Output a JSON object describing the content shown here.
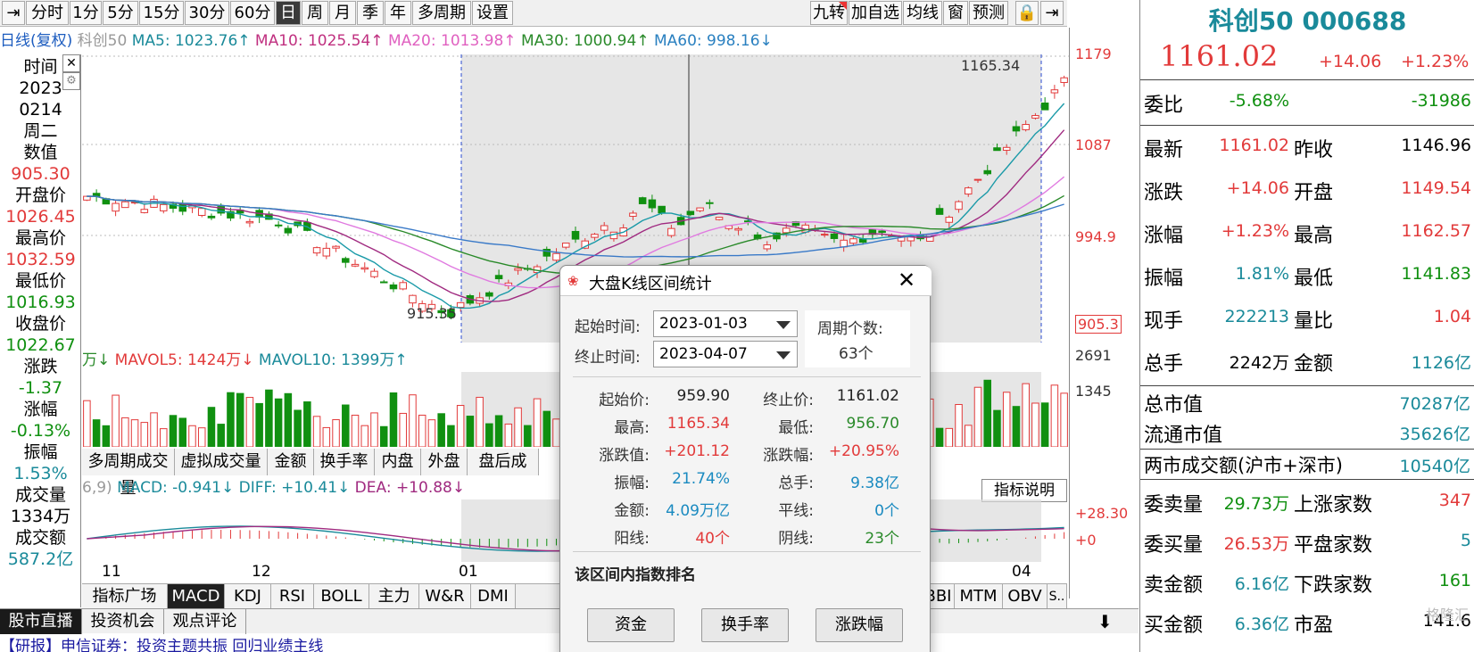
{
  "toolbar": {
    "items": [
      "分时",
      "1分",
      "5分",
      "15分",
      "30分",
      "60分",
      "日",
      "周",
      "月",
      "季",
      "年",
      "多周期",
      "设置"
    ],
    "right_items": [
      "九转",
      "加自选",
      "均线",
      "窗",
      "预测"
    ]
  },
  "indicator_line": {
    "mode": "日线(复权)",
    "name": "科创50",
    "ma5": "MA5: 1023.76↑",
    "ma10": "MA10: 1025.54↑",
    "ma20": "MA20: 1013.98↑",
    "ma30": "MA30: 1000.94↑",
    "ma60": "MA60: 998.16↓"
  },
  "left_panel": {
    "time_label": "时间",
    "year": "2023",
    "date": "0214",
    "weekday": "周二",
    "value_label": "数值",
    "value": "905.30",
    "open_label": "开盘价",
    "open": "1026.45",
    "high_label": "最高价",
    "high": "1032.59",
    "low_label": "最低价",
    "low": "1016.93",
    "close_label": "收盘价",
    "close": "1022.67",
    "change_label": "涨跌",
    "change": "-1.37",
    "pct_label": "涨幅",
    "pct": "-0.13%",
    "amp_label": "振幅",
    "amp": "1.53%",
    "vol_label": "成交量",
    "vol": "1334万",
    "amt_label": "成交额",
    "amt": "587.2亿"
  },
  "price_axis": {
    "p1": "1179",
    "p2": "1087",
    "p3": "994.9",
    "p4": "905.3",
    "v1": "2691",
    "v2": "1345",
    "m1": "+28.30",
    "m2": "+0"
  },
  "annotations": {
    "high_marker": "1165.34",
    "low_marker": "915.35"
  },
  "vol_header": {
    "prefix": "万↓",
    "mavol5": "MAVOL5: 1424万↓",
    "mavol10": "MAVOL10: 1399万↑"
  },
  "mid_tabs": [
    "多周期成交量",
    "虚拟成交量",
    "金额",
    "换手率",
    "内盘",
    "外盘",
    "盘后成"
  ],
  "macd_header": {
    "prefix": "6,9)",
    "macd": "MACD: -0.941↓",
    "diff": "DIFF: +10.41↓",
    "dea": "DEA: +10.88↓"
  },
  "indicator_tip": "指标说明",
  "x_axis": {
    "m11": "11",
    "m12": "12",
    "m01": "01",
    "m04": "04"
  },
  "bottom_tabs": [
    "指标广场",
    "MACD",
    "KDJ",
    "RSI",
    "BOLL",
    "主力",
    "W&R",
    "DMI",
    "BBI",
    "MTM",
    "OBV",
    "S.."
  ],
  "bottom_bar": [
    "股市直播",
    "投资机会",
    "观点评论"
  ],
  "news_line": "【研报】申信证券：投资主题共振 回归业绩主线",
  "right_panel": {
    "title": "科创50 000688",
    "price": "1161.02",
    "change": "+14.06",
    "pct": "+1.23%",
    "rows": [
      {
        "l": "委比",
        "v": "-5.68%",
        "l2": "",
        "v2": "-31986"
      },
      {
        "l": "最新",
        "v": "1161.02",
        "l2": "昨收",
        "v2": "1146.96"
      },
      {
        "l": "涨跌",
        "v": "+14.06",
        "l2": "开盘",
        "v2": "1149.54"
      },
      {
        "l": "涨幅",
        "v": "+1.23%",
        "l2": "最高",
        "v2": "1162.57"
      },
      {
        "l": "振幅",
        "v": "1.81%",
        "l2": "最低",
        "v2": "1141.83"
      },
      {
        "l": "现手",
        "v": "222213",
        "l2": "量比",
        "v2": "1.04"
      },
      {
        "l": "总手",
        "v": "2242万",
        "l2": "金额",
        "v2": "1126亿"
      }
    ],
    "mkt": [
      {
        "l": "总市值",
        "v": "70287亿"
      },
      {
        "l": "流通市值",
        "v": "35626亿"
      },
      {
        "l": "两市成交额(沪市+深市)",
        "v": "10540亿"
      }
    ],
    "rows2": [
      {
        "l": "委卖量",
        "v": "29.73万",
        "l2": "上涨家数",
        "v2": "347"
      },
      {
        "l": "委买量",
        "v": "26.53万",
        "l2": "平盘家数",
        "v2": "5"
      },
      {
        "l": "卖金额",
        "v": "6.16亿",
        "l2": "下跌家数",
        "v2": "161"
      },
      {
        "l": "买金额",
        "v": "6.36亿",
        "l2": "市盈",
        "v2": "141.6"
      }
    ],
    "watermark": "格隆汇"
  },
  "dialog": {
    "title": "大盘K线区间统计",
    "start_label": "起始时间:",
    "start": "2023-01-03",
    "end_label": "终止时间:",
    "end": "2023-04-07",
    "period_label": "周期个数:",
    "period": "63个",
    "stats": [
      {
        "l": "起始价:",
        "v": "959.90",
        "l2": "终止价:",
        "v2": "1161.02"
      },
      {
        "l": "最高:",
        "v": "1165.34",
        "l2": "最低:",
        "v2": "956.70"
      },
      {
        "l": "涨跌值:",
        "v": "+201.12",
        "l2": "涨跌幅:",
        "v2": "+20.95%"
      },
      {
        "l": "振幅:",
        "v": "21.74%",
        "l2": "总手:",
        "v2": "9.38亿"
      },
      {
        "l": "金额:",
        "v": "4.09万亿",
        "l2": "平线:",
        "v2": "0个"
      },
      {
        "l": "阳线:",
        "v": "40个",
        "l2": "阴线:",
        "v2": "23个"
      }
    ],
    "rank_title": "该区间内指数排名",
    "buttons": [
      "资金",
      "换手率",
      "涨跌幅"
    ]
  }
}
